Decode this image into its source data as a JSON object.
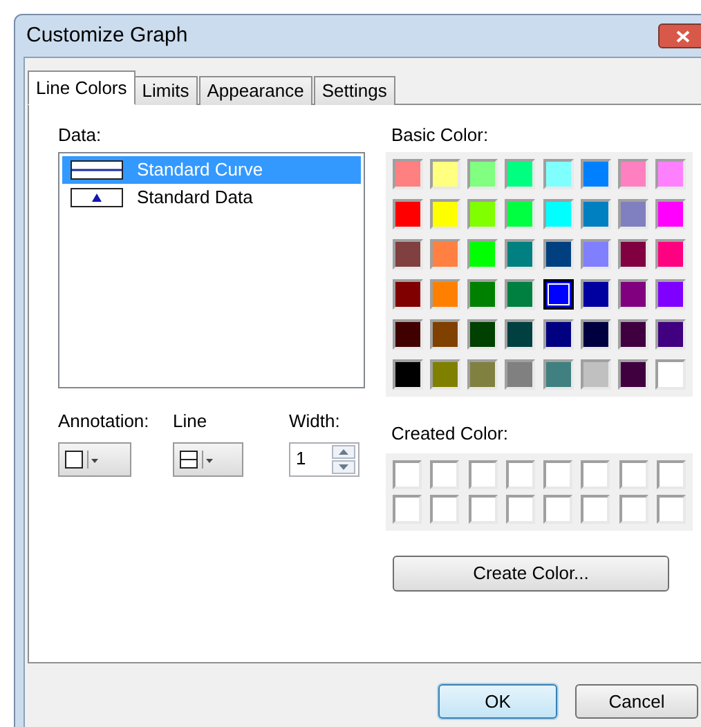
{
  "window": {
    "title": "Customize Graph"
  },
  "tabs": [
    {
      "label": "Line Colors",
      "selected": true
    },
    {
      "label": "Limits",
      "selected": false
    },
    {
      "label": "Appearance",
      "selected": false
    },
    {
      "label": "Settings",
      "selected": false
    }
  ],
  "data_list": {
    "label": "Data:",
    "items": [
      {
        "label": "Standard Curve",
        "kind": "line",
        "selected": true
      },
      {
        "label": "Standard Data",
        "kind": "marker",
        "selected": false
      }
    ]
  },
  "basic_color": {
    "label": "Basic Color:",
    "rows": [
      [
        {
          "color": "#ff8080",
          "selected": false
        },
        {
          "color": "#ffff80",
          "selected": false
        },
        {
          "color": "#80ff80",
          "selected": false
        },
        {
          "color": "#00ff80",
          "selected": false
        },
        {
          "color": "#80ffff",
          "selected": false
        },
        {
          "color": "#0080ff",
          "selected": false
        },
        {
          "color": "#ff80c0",
          "selected": false
        },
        {
          "color": "#ff80ff",
          "selected": false
        }
      ],
      [
        {
          "color": "#ff0000",
          "selected": false
        },
        {
          "color": "#ffff00",
          "selected": false
        },
        {
          "color": "#80ff00",
          "selected": false
        },
        {
          "color": "#00ff40",
          "selected": false
        },
        {
          "color": "#00ffff",
          "selected": false
        },
        {
          "color": "#0080c0",
          "selected": false
        },
        {
          "color": "#8080c0",
          "selected": false
        },
        {
          "color": "#ff00ff",
          "selected": false
        }
      ],
      [
        {
          "color": "#804040",
          "selected": false
        },
        {
          "color": "#ff8040",
          "selected": false
        },
        {
          "color": "#00ff00",
          "selected": false
        },
        {
          "color": "#008080",
          "selected": false
        },
        {
          "color": "#004080",
          "selected": false
        },
        {
          "color": "#8080ff",
          "selected": false
        },
        {
          "color": "#800040",
          "selected": false
        },
        {
          "color": "#ff0080",
          "selected": false
        }
      ],
      [
        {
          "color": "#800000",
          "selected": false
        },
        {
          "color": "#ff8000",
          "selected": false
        },
        {
          "color": "#008000",
          "selected": false
        },
        {
          "color": "#008040",
          "selected": false
        },
        {
          "color": "#0000ff",
          "selected": true
        },
        {
          "color": "#0000a0",
          "selected": false
        },
        {
          "color": "#800080",
          "selected": false
        },
        {
          "color": "#8000ff",
          "selected": false
        }
      ],
      [
        {
          "color": "#400000",
          "selected": false
        },
        {
          "color": "#804000",
          "selected": false
        },
        {
          "color": "#004000",
          "selected": false
        },
        {
          "color": "#004040",
          "selected": false
        },
        {
          "color": "#000080",
          "selected": false
        },
        {
          "color": "#000040",
          "selected": false
        },
        {
          "color": "#400040",
          "selected": false
        },
        {
          "color": "#400080",
          "selected": false
        }
      ],
      [
        {
          "color": "#000000",
          "selected": false
        },
        {
          "color": "#808000",
          "selected": false
        },
        {
          "color": "#808040",
          "selected": false
        },
        {
          "color": "#808080",
          "selected": false
        },
        {
          "color": "#408080",
          "selected": false
        },
        {
          "color": "#c0c0c0",
          "selected": false
        },
        {
          "color": "#400040",
          "selected": false
        },
        {
          "color": "#ffffff",
          "selected": false
        }
      ]
    ]
  },
  "annotation": {
    "label": "Annotation:"
  },
  "line": {
    "label": "Line"
  },
  "width": {
    "label": "Width:",
    "value": "1"
  },
  "created_color": {
    "label": "Created Color:"
  },
  "create_color_button": {
    "label": "Create Color..."
  },
  "buttons": [
    {
      "label": "OK",
      "default": true
    },
    {
      "label": "Cancel",
      "default": false
    }
  ]
}
